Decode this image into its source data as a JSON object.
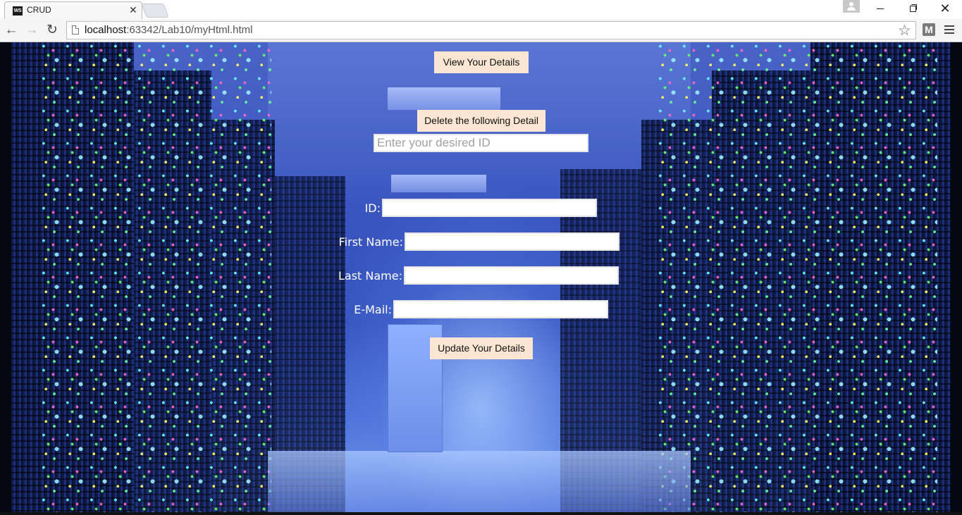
{
  "browser": {
    "tab_title": "CRUD",
    "tab_favicon_text": "WS",
    "url_host": "localhost",
    "url_path": ":63342/Lab10/myHtml.html",
    "extension_label": "M",
    "icons": [
      "back-icon",
      "forward-icon",
      "reload-icon",
      "page-icon",
      "star-icon",
      "extension-icon",
      "menu-icon",
      "profile-icon"
    ]
  },
  "page": {
    "view_button": "View Your Details",
    "delete_button": "Delete the following Detail",
    "delete_input_placeholder": "Enter your desired ID",
    "form": {
      "id_label": "ID:",
      "first_name_label": "First Name:",
      "last_name_label": "Last Name:",
      "email_label": "E-Mail:",
      "id_value": "",
      "first_name_value": "",
      "last_name_value": "",
      "email_value": ""
    },
    "update_button": "Update Your Details"
  }
}
